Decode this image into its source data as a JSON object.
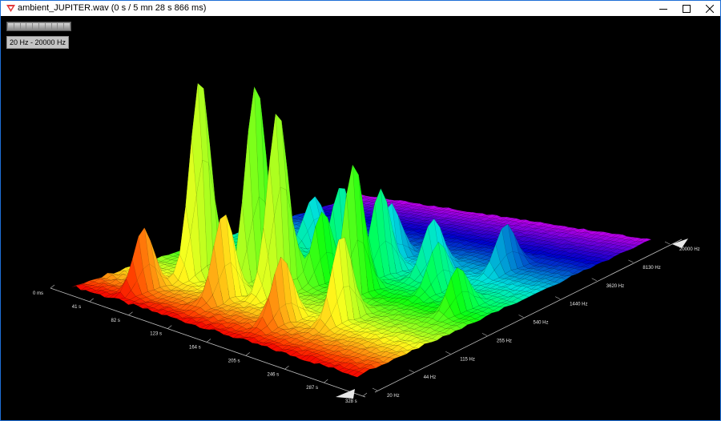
{
  "window": {
    "title": "ambient_JUPITER.wav (0 s / 5 mn 28 s 866 ms)",
    "controls": [
      "minimize-icon",
      "maximize-icon",
      "close-icon"
    ]
  },
  "toolbar": {
    "range_label": "20 Hz - 20000 Hz"
  },
  "time_axis": {
    "labels": [
      "0 ms",
      "41 s",
      "82 s",
      "123 s",
      "164 s",
      "205 s",
      "246 s",
      "287 s",
      "328 s"
    ]
  },
  "freq_axis": {
    "labels": [
      "20 Hz",
      "44 Hz",
      "115 Hz",
      "255 Hz",
      "540 Hz",
      "1440 Hz",
      "3620 Hz",
      "8130 Hz",
      "20000 Hz"
    ]
  },
  "colors": {
    "background": "#000000",
    "low_freq": "#ff2a2a",
    "mid_freq": "#33ff33",
    "high_freq": "#b040ff"
  }
}
